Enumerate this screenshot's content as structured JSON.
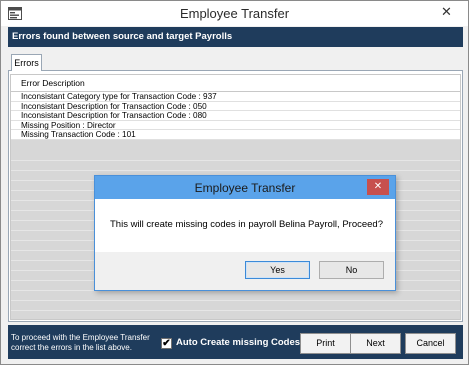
{
  "window": {
    "title": "Employee Transfer",
    "close_glyph": "✕"
  },
  "header": {
    "text": "Errors found between source and target Payrolls"
  },
  "tabs": [
    {
      "label": "Errors"
    }
  ],
  "grid": {
    "column_header": "Error Description",
    "rows": [
      "Inconsistant Category type for Transaction Code : 937",
      "Inconsistant Description for Transaction Code : 050",
      "Inconsistant Description for Transaction Code : 080",
      "Missing Position : Director",
      "Missing Transaction Code : 101"
    ]
  },
  "footer": {
    "message_line1": "To proceed with the Employee Transfer",
    "message_line2": "correct the errors in the list above.",
    "checkbox_checked": true,
    "checkbox_mark": "✔",
    "checkbox_label": "Auto Create missing Codes",
    "print_label": "Print",
    "next_label": "Next",
    "cancel_label": "Cancel"
  },
  "dialog": {
    "title": "Employee Transfer",
    "close_glyph": "✕",
    "message": "This will create missing codes in payroll Belina Payroll, Proceed?",
    "yes_label": "Yes",
    "no_label": "No"
  },
  "colors": {
    "header_band": "#1f3c5c",
    "dialog_title": "#5aa3ea",
    "dialog_close": "#c7504e"
  },
  "icons": {
    "app_icon": "app-icon",
    "close_icon": "close-icon"
  }
}
